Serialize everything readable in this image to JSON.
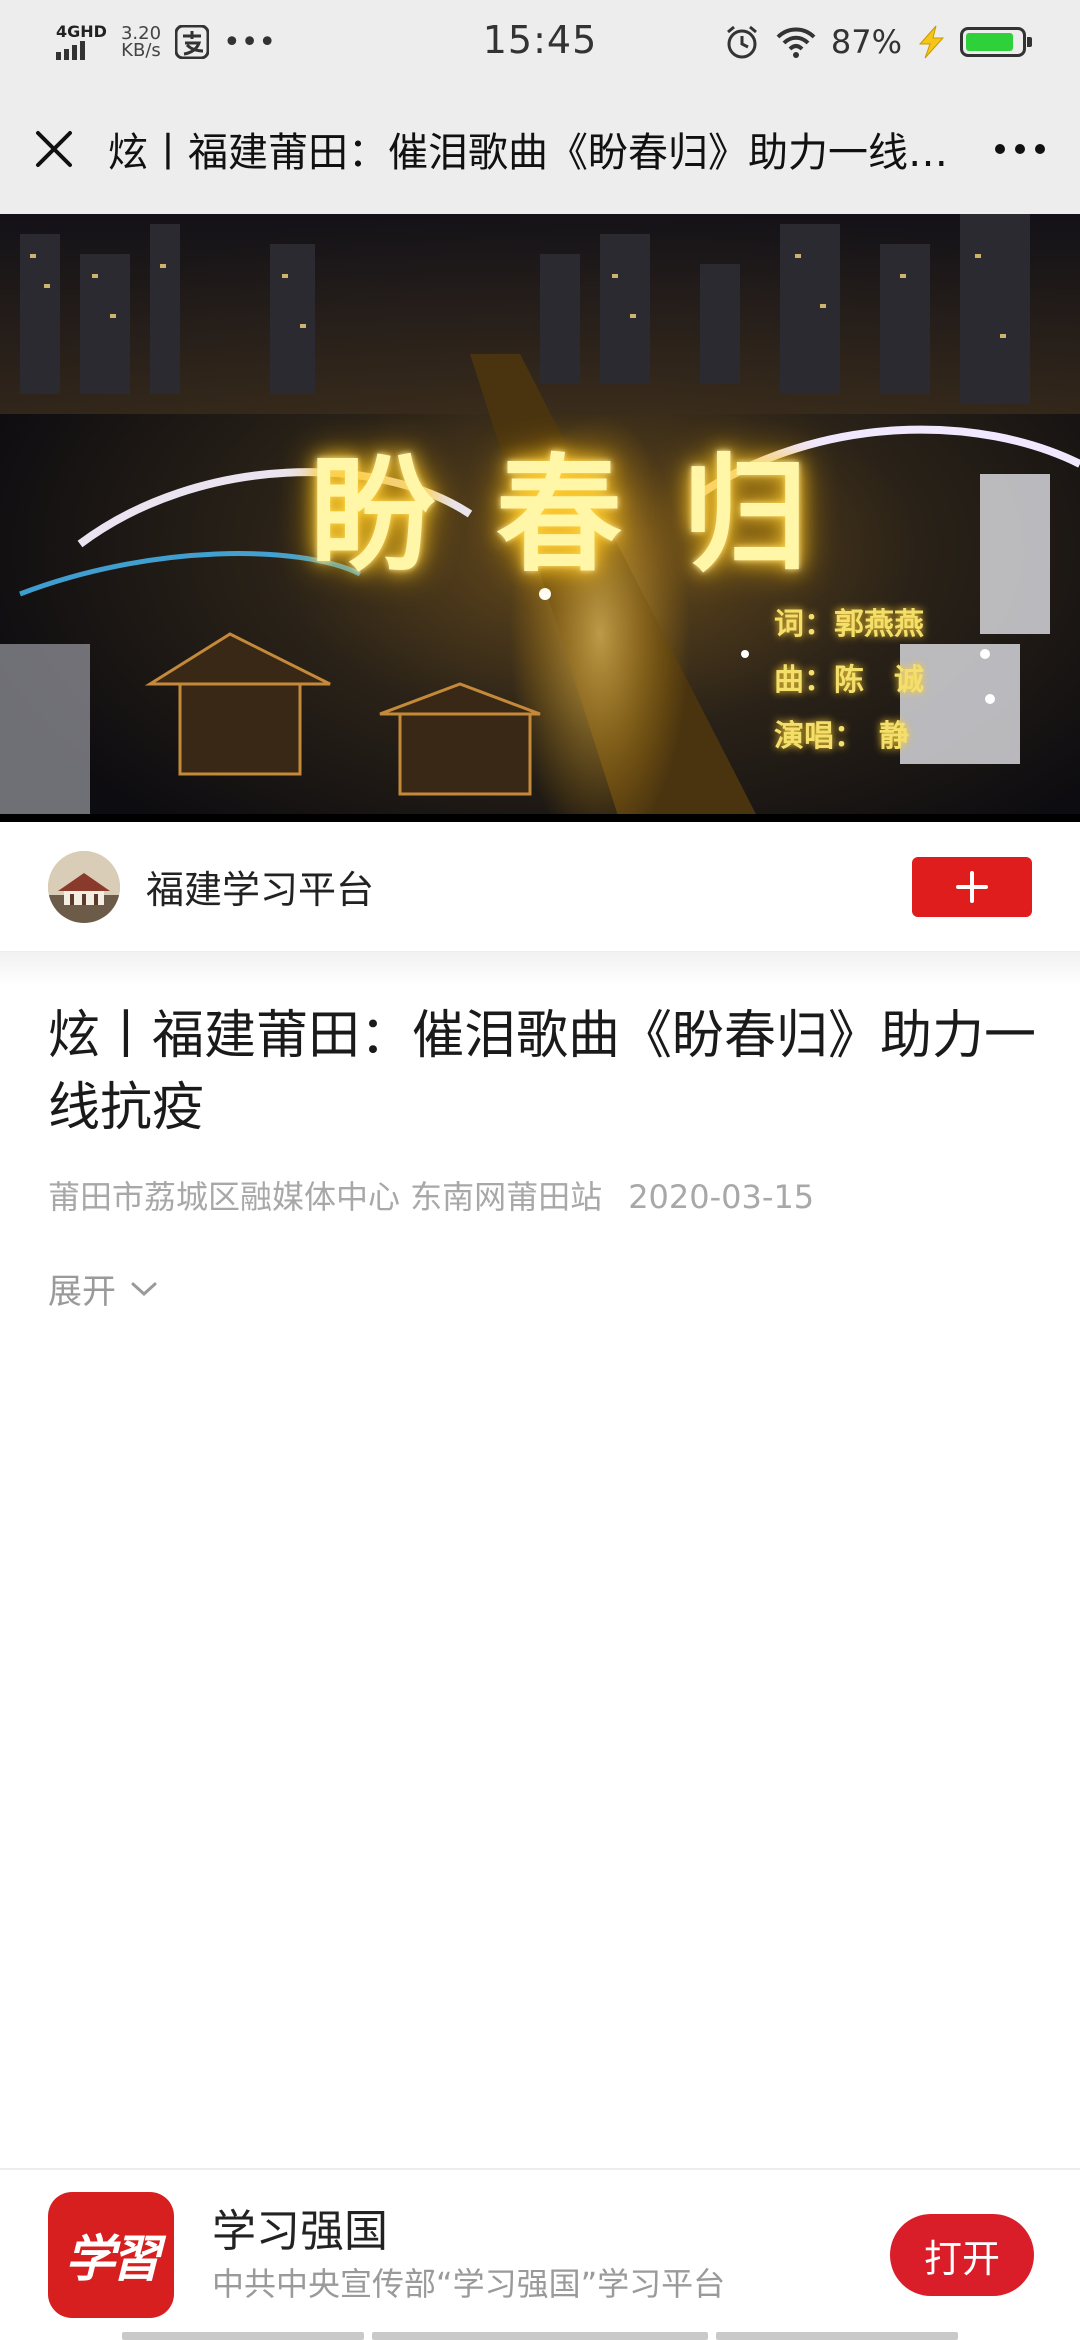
{
  "status_bar": {
    "network": "4GHD",
    "speed_value": "3.20",
    "speed_unit": "KB/s",
    "time": "15:45",
    "battery_percent": "87%",
    "battery_level": 0.87,
    "icons": [
      "signal-icon",
      "alipay-icon",
      "more-notifications-icon",
      "alarm-icon",
      "wifi-icon",
      "charging-icon",
      "battery-icon"
    ]
  },
  "title_bar": {
    "title": "炫丨福建莆田：催泪歌曲《盼春归》助力一线抗疫"
  },
  "hero": {
    "song_title": "盼春归",
    "credit_lyrics": "词：郭燕燕",
    "credit_music": "曲：陈　诚",
    "credit_singer": "演唱：　静"
  },
  "account": {
    "name": "福建学习平台",
    "follow_label": "+"
  },
  "article": {
    "title": "炫丨福建莆田：催泪歌曲《盼春归》助力一线抗疫",
    "source": "莆田市荔城区融媒体中心 东南网莆田站",
    "date": "2020-03-15",
    "expand_label": "展开"
  },
  "app_banner": {
    "logo_text": "学習",
    "name": "学习强国",
    "description": "中共中央宣传部“学习强国”学习平台",
    "open_label": "打开"
  },
  "colors": {
    "brand_red": "#e01d1d",
    "open_button_red": "#d91e2a",
    "battery_green": "#2fd13a",
    "header_bg": "#ededed"
  }
}
